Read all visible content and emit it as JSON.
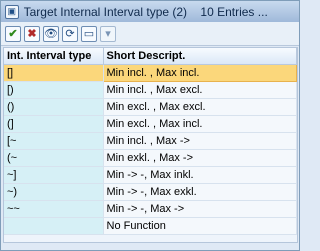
{
  "window": {
    "title": "Target Internal Interval type (2)",
    "entries": "10 Entries ..."
  },
  "toolbar": {
    "buttons": [
      {
        "name": "continue-button",
        "symbol": "✔",
        "style": "green"
      },
      {
        "name": "cancel-button",
        "symbol": "✖",
        "style": "red"
      },
      {
        "name": "find-button",
        "symbol": "👁",
        "style": ""
      },
      {
        "name": "find-next-button",
        "symbol": "⟳",
        "style": ""
      },
      {
        "name": "print-button",
        "symbol": "▭",
        "style": ""
      },
      {
        "name": "dropdown-button",
        "symbol": "▾",
        "style": "disabled"
      }
    ]
  },
  "table": {
    "headers": [
      "Int. Interval type",
      "Short Descript."
    ],
    "rows": [
      {
        "type": "[]",
        "desc": "Min incl. , Max incl.",
        "selected": true
      },
      {
        "type": "[)",
        "desc": "Min incl. , Max excl.",
        "selected": false
      },
      {
        "type": "()",
        "desc": "Min excl. , Max excl.",
        "selected": false
      },
      {
        "type": "(]",
        "desc": "Min excl. , Max incl.",
        "selected": false
      },
      {
        "type": "[~",
        "desc": "Min incl. , Max ->",
        "selected": false
      },
      {
        "type": "(~",
        "desc": "Min exkl. , Max ->",
        "selected": false
      },
      {
        "type": "~]",
        "desc": "Min -> -, Max inkl.",
        "selected": false
      },
      {
        "type": "~)",
        "desc": "Min -> -, Max exkl.",
        "selected": false
      },
      {
        "type": "~~",
        "desc": "Min -> -, Max ->",
        "selected": false
      },
      {
        "type": "",
        "desc": "No Function",
        "selected": false
      }
    ]
  }
}
